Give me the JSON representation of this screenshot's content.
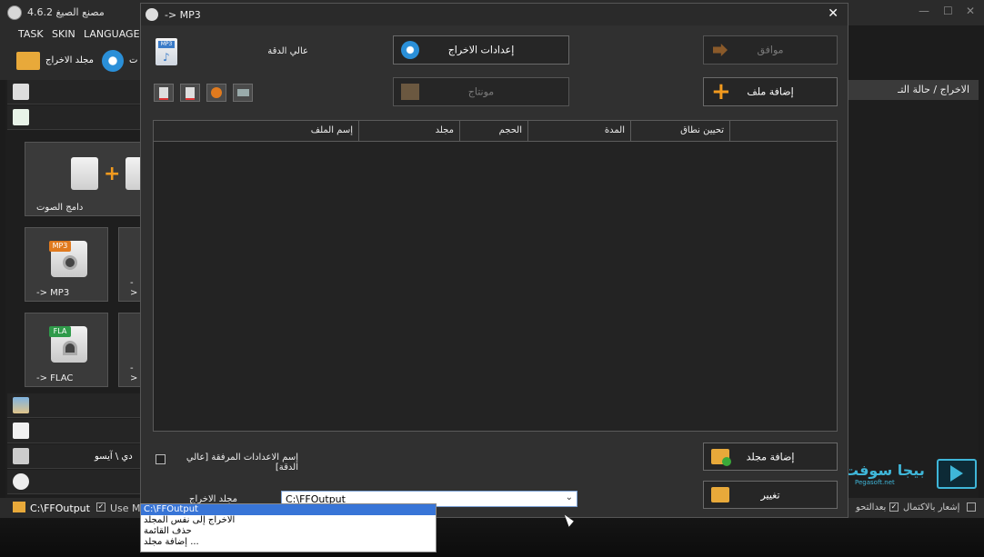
{
  "main_window": {
    "title": "مصنع الصيغ 4.6.2",
    "menu": [
      "TASK",
      "SKIN",
      "LANGUAGE"
    ],
    "toolbar": {
      "output_folder_label": "مجلد الاخراج",
      "settings_partial": "ت"
    },
    "right_panel_header": "الاخراج / حالة التـ",
    "tiles": [
      {
        "label": "دامج الصوت"
      },
      {
        "label": "-> MP3",
        "badge": "MP3"
      },
      {
        "label": "-> FLAC",
        "badge": "FLA"
      },
      {
        "label": "->"
      },
      {
        "label": "->"
      }
    ],
    "side_disc_label": "دي \\ آيسو",
    "status": {
      "path": "C:\\FFOutput",
      "use_label": "Use M",
      "notify_label": "إشعار بالاكتمال",
      "after_label": "بعدالتحو"
    }
  },
  "dialog": {
    "title": "-> MP3",
    "quality_label": "عالي الدقة",
    "buttons": {
      "output_settings": "إعدادات الاخراج",
      "ok": "موافق",
      "add_file": "إضافة ملف",
      "montage": "مونتاج",
      "add_folder": "إضافة مجلد",
      "change": "تغيير"
    },
    "table_columns": [
      "إسم الملف",
      "مجلد",
      "الحجم",
      "المدة",
      "تحيين نطاق",
      ""
    ],
    "checkbox_label": "إسم الاعدادات المرفقة [عالي الدقة]",
    "checkbox_checked": false,
    "output_folder_label": "مجلد الاخراج",
    "output_select": {
      "value": "C:\\FFOutput",
      "options": [
        "C:\\FFOutput",
        "الاخراج إلى نفس المجلد",
        "حذف القائمة",
        "إضافة مجلد ..."
      ]
    }
  },
  "watermark": {
    "text": "بيجا سوفت",
    "sub": "Pegasoft.net"
  },
  "colors": {
    "accent_orange": "#f29a1e",
    "selection_blue": "#3875d7",
    "watermark": "#3fb6d8"
  }
}
